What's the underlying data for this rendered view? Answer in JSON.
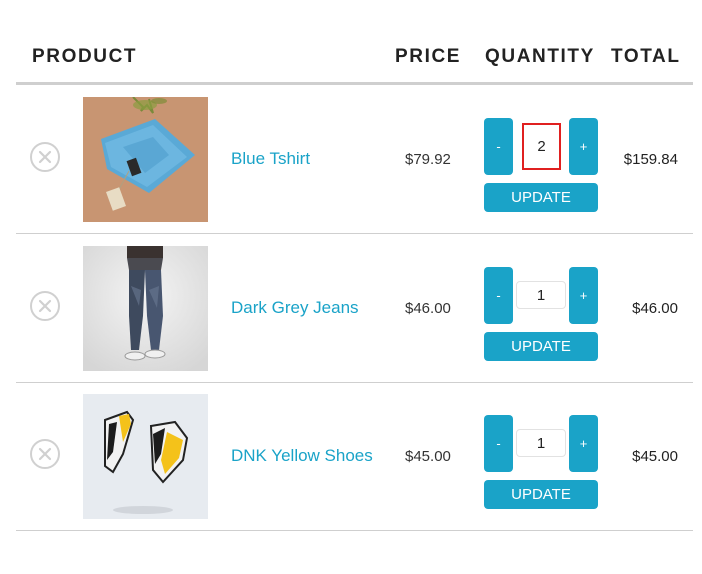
{
  "header": {
    "product": "PRODUCT",
    "price": "PRICE",
    "quantity": "QUANTITY",
    "total": "TOTAL"
  },
  "items": [
    {
      "name": "Blue Tshirt",
      "price": "$79.92",
      "quantity": "2",
      "minus": "-",
      "plus": "+",
      "update": "UPDATE",
      "total": "$159.84"
    },
    {
      "name": "Dark Grey Jeans",
      "price": "$46.00",
      "quantity": "1",
      "minus": "-",
      "plus": "+",
      "update": "UPDATE",
      "total": "$46.00"
    },
    {
      "name": "DNK Yellow Shoes",
      "price": "$45.00",
      "quantity": "1",
      "minus": "-",
      "plus": "+",
      "update": "UPDATE",
      "total": "$45.00"
    }
  ],
  "colors": {
    "accent": "#1aa3c8",
    "highlight": "#e02020",
    "divider": "#cfcfcf"
  },
  "icons": {
    "remove": "close-circle-icon"
  }
}
